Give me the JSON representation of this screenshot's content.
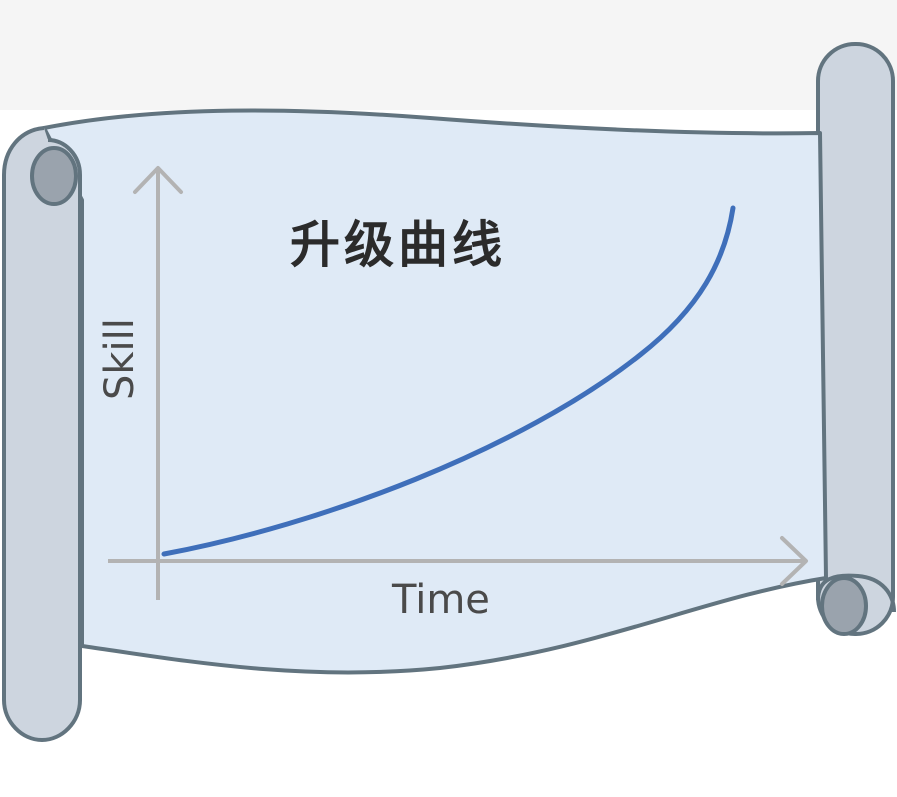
{
  "diagram": {
    "title": "升级曲线",
    "x_axis_label": "Time",
    "y_axis_label": "Skill",
    "curve_shape": "exponential-increase"
  },
  "colors": {
    "page_background": "#ffffff",
    "top_band": "#f5f5f5",
    "paper_fill": "#dfeaf6",
    "outline": "#62747f",
    "roller_fill": "#cdd5df",
    "roller_inner": "#9aa3ad",
    "axis_color": "#b3b3b3",
    "curve_color": "#3f6fba"
  }
}
